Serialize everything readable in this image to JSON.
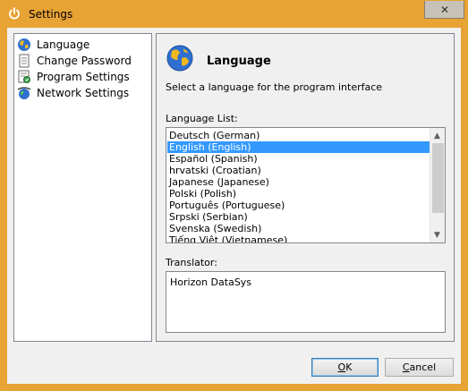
{
  "window": {
    "title": "Settings",
    "close_glyph": "✕",
    "title_icon": "power-icon",
    "accent_color": "#e8a335"
  },
  "sidebar": {
    "items": [
      {
        "label": "Language",
        "icon": "globe-icon"
      },
      {
        "label": "Change Password",
        "icon": "document-icon"
      },
      {
        "label": "Program Settings",
        "icon": "settings-sheet-icon"
      },
      {
        "label": "Network Settings",
        "icon": "network-globe-icon"
      }
    ]
  },
  "panel": {
    "title": "Language",
    "icon": "globe-icon",
    "description": "Select a language for the program interface",
    "list_label": "Language List:",
    "languages": [
      "Deutsch (German)",
      "English (English)",
      "Español (Spanish)",
      "hrvatski (Croatian)",
      "Japanese (Japanese)",
      "Polski (Polish)",
      "Português (Portuguese)",
      "Srpski (Serbian)",
      "Svenska (Swedish)",
      "Tiếng Việt (Vietnamese)"
    ],
    "selected_language": "English (English)",
    "translator_label": "Translator:",
    "translator_value": "Horizon DataSys"
  },
  "buttons": {
    "ok_mnemonic": "O",
    "ok_rest": "K",
    "cancel_mnemonic": "C",
    "cancel_rest": "ancel"
  }
}
